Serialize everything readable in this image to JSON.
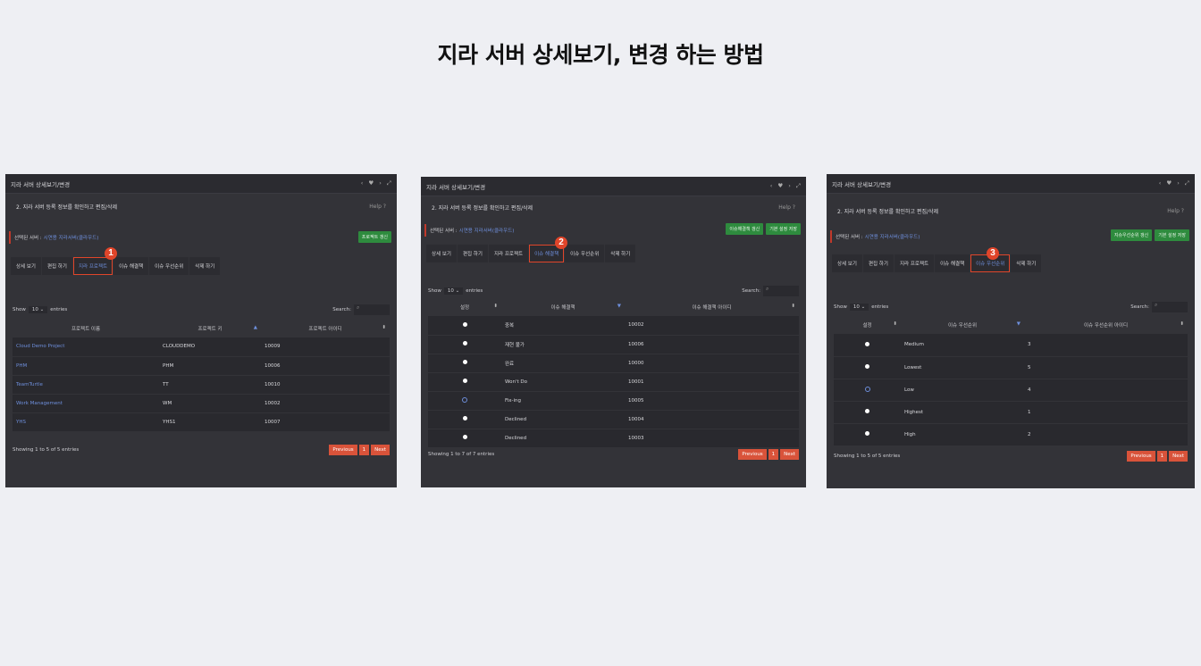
{
  "page_title": "지라 서버 상세보기, 변경 하는 방법",
  "panels": [
    {
      "window_title": "지라 서버 상세보기/변경",
      "subtitle": "2. 지라 서버 등록 정보를 확인하고 편집/삭제",
      "help": "Help ?",
      "selected_label": "선택된 서버 :",
      "selected_value": "시연용 지라서버(클라우드)",
      "green_buttons": [
        "프로젝트 갱신"
      ],
      "tabs": [
        "상세 보기",
        "편집 하기",
        "지라 프로젝트",
        "이슈 해결책",
        "이슈 우선순위",
        "삭제 하기"
      ],
      "marker": "1",
      "show_label": "Show",
      "entries_value": "10",
      "entries_label": "entries",
      "search_label": "Search:",
      "columns": [
        "프로젝트 이름",
        "프로젝트 키",
        "프로젝트 아이디"
      ],
      "rows": [
        [
          "Cloud Demo Project",
          "CLOUDDEMO",
          "10009"
        ],
        [
          "PHM",
          "PHM",
          "10006"
        ],
        [
          "TeamTurtle",
          "TT",
          "10010"
        ],
        [
          "Work Management",
          "WM",
          "10002"
        ],
        [
          "YHS",
          "YHS1",
          "10007"
        ]
      ],
      "footer_text": "Showing 1 to 5 of 5 entries",
      "pager": [
        "Previous",
        "1",
        "Next"
      ]
    },
    {
      "window_title": "지라 서버 상세보기/변경",
      "subtitle": "2. 지라 서버 등록 정보를 확인하고 편집/삭제",
      "help": "Help ?",
      "selected_label": "선택된 서버 :",
      "selected_value": "시연용 지라서버(클라우드)",
      "green_buttons": [
        "이슈해결책 갱신",
        "기본 설정 저장"
      ],
      "tabs": [
        "상세 보기",
        "편집 하기",
        "지라 프로젝트",
        "이슈 해결책",
        "이슈 우선순위",
        "삭제 하기"
      ],
      "marker": "2",
      "show_label": "Show",
      "entries_value": "10",
      "entries_label": "entries",
      "search_label": "Search:",
      "columns": [
        "설정",
        "이슈 해결책",
        "이슈 해결책 아이디"
      ],
      "rows": [
        [
          "",
          "중복",
          "10002"
        ],
        [
          "",
          "재현 불가",
          "10006"
        ],
        [
          "",
          "완료",
          "10000"
        ],
        [
          "",
          "Won't Do",
          "10001"
        ],
        [
          "",
          "Fix-ing",
          "10005"
        ],
        [
          "",
          "Declined",
          "10004"
        ],
        [
          "",
          "Declined",
          "10003"
        ]
      ],
      "active_row": 4,
      "footer_text": "Showing 1 to 7 of 7 entries",
      "pager": [
        "Previous",
        "1",
        "Next"
      ]
    },
    {
      "window_title": "지라 서버 상세보기/변경",
      "subtitle": "2. 지라 서버 등록 정보를 확인하고 편집/삭제",
      "help": "Help ?",
      "selected_label": "선택된 서버 :",
      "selected_value": "시연용 지라서버(클라우드)",
      "green_buttons": [
        "지슈우선순위 갱신",
        "기본 설정 저장"
      ],
      "tabs": [
        "상세 보기",
        "편집 하기",
        "지라 프로젝트",
        "이슈 해결책",
        "이슈 우선순위",
        "삭제 하기"
      ],
      "marker": "3",
      "show_label": "Show",
      "entries_value": "10",
      "entries_label": "entries",
      "search_label": "Search:",
      "columns": [
        "설정",
        "이슈 우선순위",
        "이슈 우선순위 아이디"
      ],
      "rows": [
        [
          "",
          "Medium",
          "3"
        ],
        [
          "",
          "Lowest",
          "5"
        ],
        [
          "",
          "Low",
          "4"
        ],
        [
          "",
          "Highest",
          "1"
        ],
        [
          "",
          "High",
          "2"
        ]
      ],
      "active_row": 2,
      "footer_text": "Showing 1 to 5 of 5 entries",
      "pager": [
        "Previous",
        "1",
        "Next"
      ]
    }
  ]
}
